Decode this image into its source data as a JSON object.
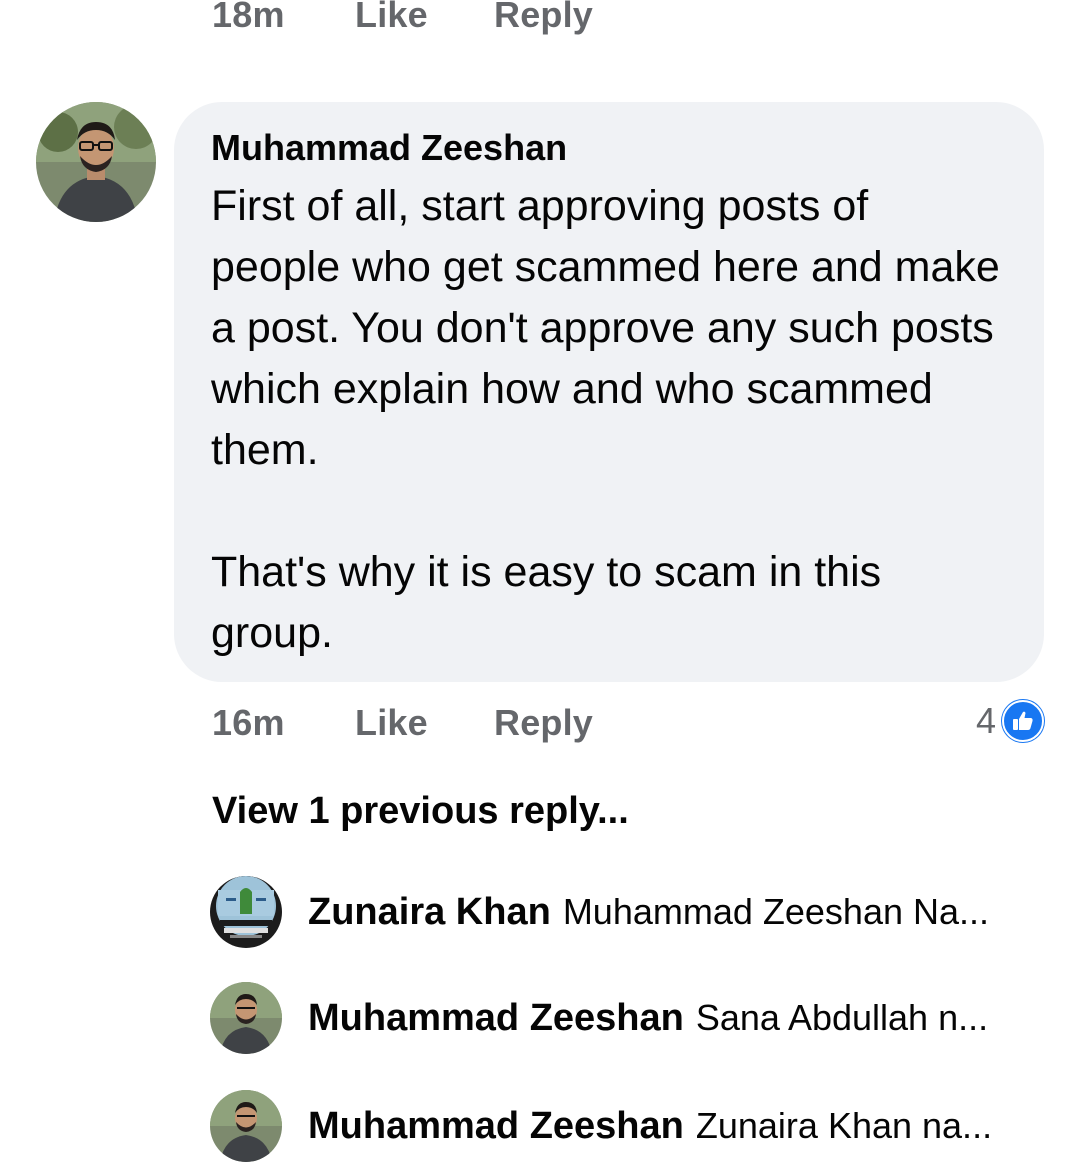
{
  "top_actions": {
    "time": "18m",
    "like": "Like",
    "reply": "Reply"
  },
  "comment": {
    "author": "Muhammad Zeeshan",
    "body": "First of all, start approving posts of people who get scammed here and make a post. You don't approve any such posts which explain how and who scammed them.\n\nThat's why it is easy to scam in this group.",
    "time": "16m",
    "like": "Like",
    "reply": "Reply",
    "reaction_count": "4",
    "reaction_icon": "thumbs-up-icon",
    "accent": "#1877f2"
  },
  "view_previous": "View 1 previous reply...",
  "replies": [
    {
      "name": "Zunaira Khan",
      "snippet": "Muhammad Zeeshan Na..."
    },
    {
      "name": "Muhammad Zeeshan",
      "snippet": "Sana Abdullah n..."
    },
    {
      "name": "Muhammad Zeeshan",
      "snippet": "Zunaira Khan na..."
    }
  ]
}
